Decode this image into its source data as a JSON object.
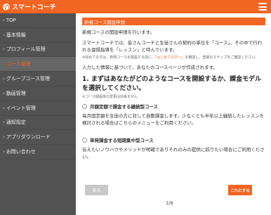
{
  "header": {
    "app_title": "スマートコーチ",
    "logo_icon": "coach-logo-icon",
    "menu_icon": "hamburger-menu-icon"
  },
  "sidebar": {
    "items": [
      {
        "label": "TOP",
        "active": false
      },
      {
        "label": "基本情報",
        "active": false
      },
      {
        "label": "プロフィール管理",
        "active": false
      },
      {
        "label": "コース管理",
        "active": true
      },
      {
        "label": "グループコース管理",
        "active": false
      },
      {
        "label": "動画管理",
        "active": false
      },
      {
        "label": "イベント管理",
        "active": false
      },
      {
        "label": "通知設定",
        "active": false
      },
      {
        "label": "アプリダウンロード",
        "active": false
      },
      {
        "label": "お問い合わせ",
        "active": false
      }
    ]
  },
  "main": {
    "section_title": "新規コース開設申請",
    "intro": "新規コースの開設申請を行います。",
    "description_1": "スマートコーチでは、皆さんコーチと生徒さんの契約の単位を「コース」、その中で行われる遠隔指導を「レッスン」と呼んでいます。",
    "note_before": "※初めての方は、新規コースを開設する前に、「",
    "note_link": "はじめての方へ",
    "note_after": "」を確認し、登録のステップをご確認ください。",
    "description_2": "入力した情報に基づいて、あなたのコースページが作成されます。",
    "question": "1. まずはあなたがどのようなコースを開設するか、課金モデルを選択してください。",
    "question_note": "※コース開設後の変更は出来ません",
    "option_1_label": "月額定額で課金する継続型コース",
    "option_1_desc": "毎月固定額を生徒の方に対して自動課金します。少なくとも半年以上継続したレッスンを検討される場合はこちらのメニューをご利用ください。",
    "option_2_label": "単発課金する短期集中型コース",
    "option_2_desc": "伝えたいノウハウやメソッドが明確でありそれのみの提供に絞りたい場合にご利用ください。"
  },
  "footer": {
    "back_label": "戻る",
    "next_label": "これにする",
    "page_indicator": "1/9"
  },
  "colors": {
    "accent": "#f26522",
    "sidebar_bg": "#525252",
    "back_button": "#c8c8c8"
  }
}
